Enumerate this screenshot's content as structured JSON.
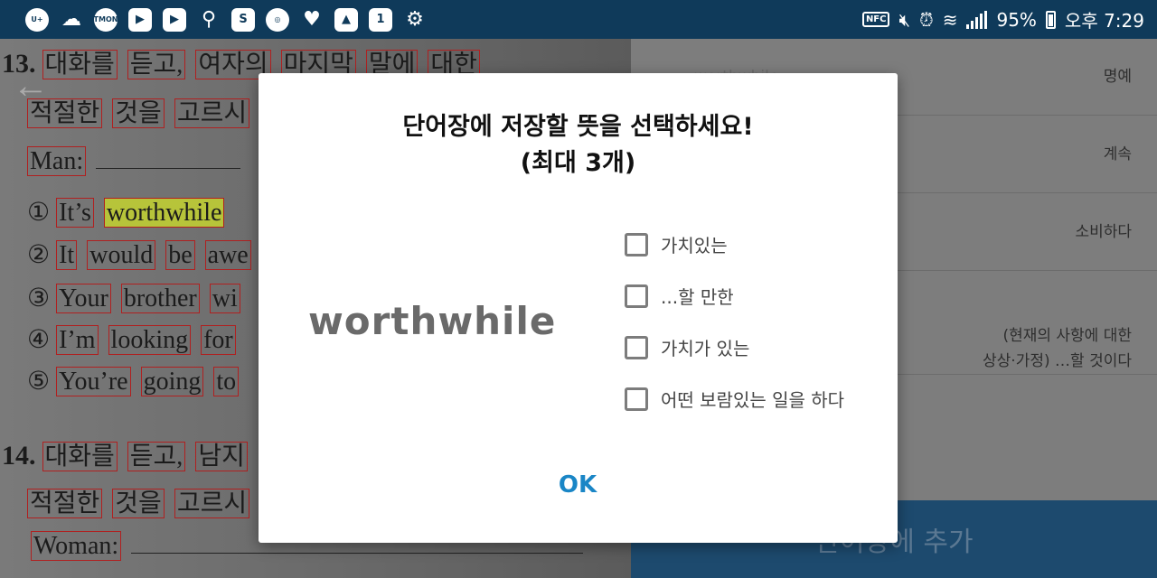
{
  "status_bar": {
    "left_icons": [
      "u-plus-icon",
      "cloud-icon",
      "tmon-icon",
      "youtube-icon",
      "youtube-icon",
      "usb-icon",
      "s-app-icon",
      "app-icon",
      "heart-icon",
      "gallery-icon",
      "one-icon",
      "android-icon"
    ],
    "nfc_label": "NFC",
    "battery": "95%",
    "time": "오후 7:29"
  },
  "background": {
    "q13_number": "13.",
    "q13_line1": [
      "대화를",
      "듣고,",
      "여자의",
      "마지막",
      "말에",
      "대한"
    ],
    "q13_line2": [
      "적절한",
      "것을",
      "고르시"
    ],
    "q13_man_label": "Man:",
    "q13_options": [
      {
        "num": "①",
        "words": [
          "It’s",
          "worthwhile"
        ]
      },
      {
        "num": "②",
        "words": [
          "It",
          "would",
          "be",
          "awe"
        ]
      },
      {
        "num": "③",
        "words": [
          "Your",
          "brother",
          "wi"
        ]
      },
      {
        "num": "④",
        "words": [
          "I’m",
          "looking",
          "for"
        ]
      },
      {
        "num": "⑤",
        "words": [
          "You’re",
          "going",
          "to"
        ]
      }
    ],
    "q14_number": "14.",
    "q14_line1": [
      "대화를",
      "듣고,",
      "남지"
    ],
    "q14_line2": [
      "적절한",
      "것을",
      "고르시"
    ],
    "q14_woman_label": "Woman:"
  },
  "side_panel": {
    "rows": [
      {
        "left": "worthwhile",
        "right": "명예"
      },
      {
        "left": "",
        "right": "계속"
      },
      {
        "left": "",
        "right": "소비하다"
      },
      {
        "left": "",
        "right": "(현재의 사항에 대한\n상상·가정) …할 것이다"
      }
    ],
    "add_button": "단어장에 추가"
  },
  "dialog": {
    "title_line1": "단어장에 저장할 뜻을 선택하세요!",
    "title_line2": "(최대 3개)",
    "word": "worthwhile",
    "options": [
      "가치있는",
      "...할 만한",
      "가치가 있는",
      "어떤 보람있는 일을 하다"
    ],
    "ok": "OK"
  },
  "colors": {
    "status_bar": "#0f3a5a",
    "ok_text": "#1a86c6",
    "add_button": "#1d4a6e"
  }
}
